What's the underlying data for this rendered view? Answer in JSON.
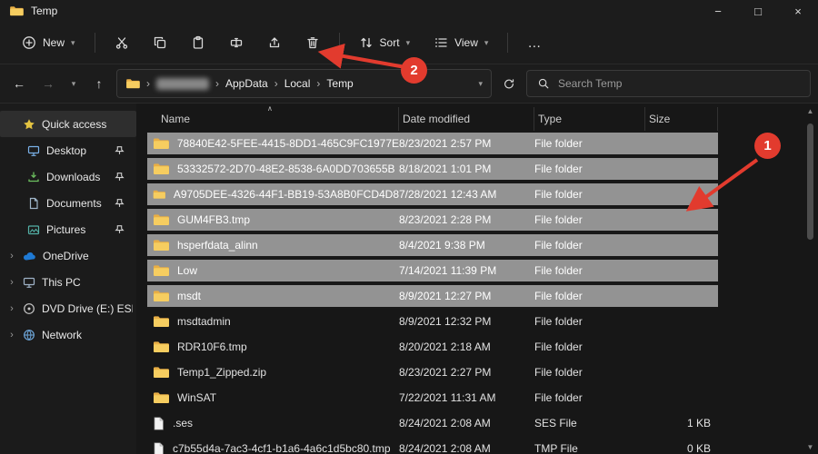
{
  "window": {
    "title": "Temp"
  },
  "icons": {
    "minimize": "−",
    "maximize": "□",
    "close": "×",
    "back": "←",
    "forward": "→",
    "up": "↑",
    "chevron_down": "▾",
    "breadcrumb_sep": "›",
    "sidebar_expand": "›",
    "more": "…",
    "sort_caret": "∧",
    "scroll_up": "▲",
    "scroll_down": "▼"
  },
  "toolbar": {
    "new_label": "New",
    "sort_label": "Sort",
    "view_label": "View"
  },
  "addressbar": {
    "segments": [
      "AppData",
      "Local",
      "Temp"
    ],
    "search_placeholder": "Search Temp"
  },
  "sidebar": {
    "items": [
      {
        "label": "Quick access"
      },
      {
        "label": "Desktop"
      },
      {
        "label": "Downloads"
      },
      {
        "label": "Documents"
      },
      {
        "label": "Pictures"
      },
      {
        "label": "OneDrive"
      },
      {
        "label": "This PC"
      },
      {
        "label": "DVD Drive (E:) ESD-"
      },
      {
        "label": "Network"
      }
    ]
  },
  "files": {
    "columns": [
      "Name",
      "Date modified",
      "Type",
      "Size"
    ],
    "rows": [
      {
        "name": "78840E42-5FEE-4415-8DD1-465C9FC1977E",
        "date": "8/23/2021 2:57 PM",
        "type": "File folder",
        "size": "",
        "icon": "folder",
        "selected": true
      },
      {
        "name": "53332572-2D70-48E2-8538-6A0DD703655B",
        "date": "8/18/2021 1:01 PM",
        "type": "File folder",
        "size": "",
        "icon": "folder",
        "selected": true
      },
      {
        "name": "A9705DEE-4326-44F1-BB19-53A8B0FCD4D8",
        "date": "7/28/2021 12:43 AM",
        "type": "File folder",
        "size": "",
        "icon": "folder",
        "selected": true
      },
      {
        "name": "GUM4FB3.tmp",
        "date": "8/23/2021 2:28 PM",
        "type": "File folder",
        "size": "",
        "icon": "folder",
        "selected": true
      },
      {
        "name": "hsperfdata_alinn",
        "date": "8/4/2021 9:38 PM",
        "type": "File folder",
        "size": "",
        "icon": "folder",
        "selected": true
      },
      {
        "name": "Low",
        "date": "7/14/2021 11:39 PM",
        "type": "File folder",
        "size": "",
        "icon": "folder",
        "selected": true
      },
      {
        "name": "msdt",
        "date": "8/9/2021 12:27 PM",
        "type": "File folder",
        "size": "",
        "icon": "folder",
        "selected": true
      },
      {
        "name": "msdtadmin",
        "date": "8/9/2021 12:32 PM",
        "type": "File folder",
        "size": "",
        "icon": "folder",
        "selected": false
      },
      {
        "name": "RDR10F6.tmp",
        "date": "8/20/2021 2:18 AM",
        "type": "File folder",
        "size": "",
        "icon": "folder",
        "selected": false
      },
      {
        "name": "Temp1_Zipped.zip",
        "date": "8/23/2021 2:27 PM",
        "type": "File folder",
        "size": "",
        "icon": "folder",
        "selected": false
      },
      {
        "name": "WinSAT",
        "date": "7/22/2021 11:31 AM",
        "type": "File folder",
        "size": "",
        "icon": "folder",
        "selected": false
      },
      {
        "name": ".ses",
        "date": "8/24/2021 2:08 AM",
        "type": "SES File",
        "size": "1 KB",
        "icon": "file",
        "selected": false
      },
      {
        "name": "c7b55d4a-7ac3-4cf1-b1a6-4a6c1d5bc80.tmp",
        "date": "8/24/2021 2:08 AM",
        "type": "TMP File",
        "size": "0 KB",
        "icon": "file",
        "selected": false
      }
    ]
  },
  "annotations": {
    "step1": "1",
    "step2": "2"
  },
  "colors": {
    "accent_red": "#e23b2e",
    "selection_grey": "#939393",
    "folder_yellow": "#f6cd60"
  }
}
